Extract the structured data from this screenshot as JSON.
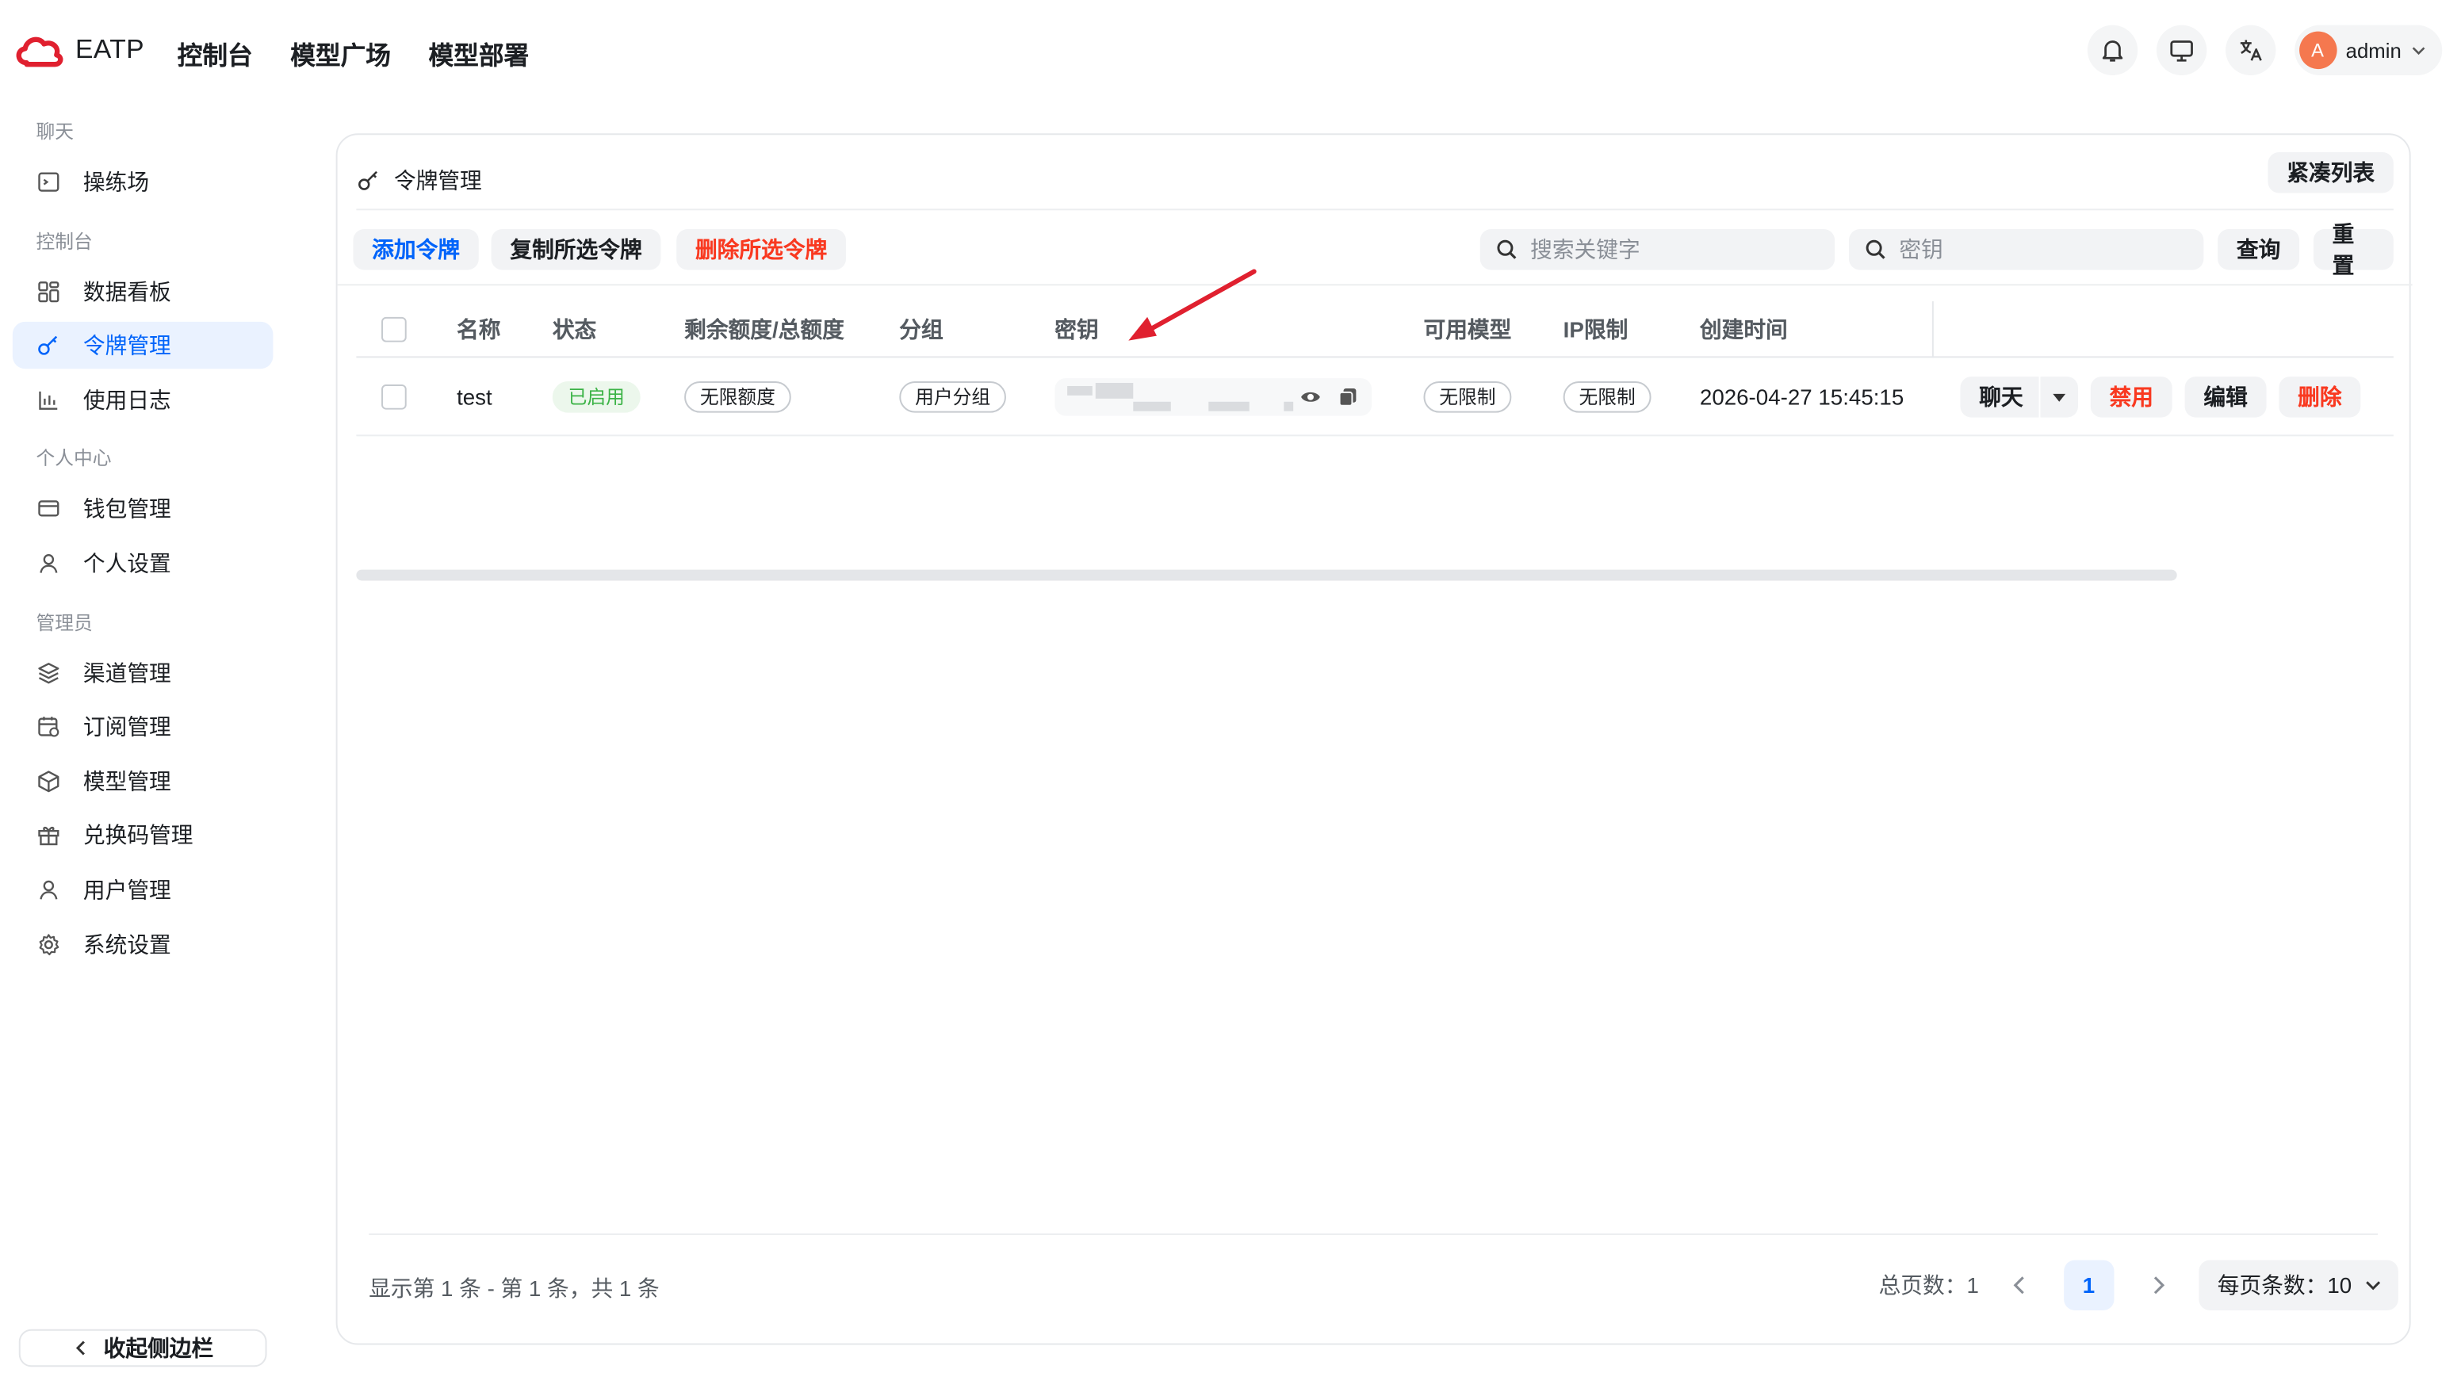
{
  "brand": {
    "name": "EATP",
    "color": "#e0202f"
  },
  "top_nav": [
    "控制台",
    "模型广场",
    "模型部署"
  ],
  "header": {
    "icons": [
      "bell-icon",
      "monitor-icon",
      "translate-icon"
    ],
    "user": {
      "avatar_letter": "A",
      "name": "admin"
    }
  },
  "sidebar": {
    "groups": [
      {
        "title": "聊天",
        "items": [
          {
            "label": "操练场",
            "icon": "terminal-icon"
          }
        ]
      },
      {
        "title": "控制台",
        "items": [
          {
            "label": "数据看板",
            "icon": "dashboard-icon"
          },
          {
            "label": "令牌管理",
            "icon": "key-icon",
            "active": true
          },
          {
            "label": "使用日志",
            "icon": "chart-icon"
          }
        ]
      },
      {
        "title": "个人中心",
        "items": [
          {
            "label": "钱包管理",
            "icon": "wallet-icon"
          },
          {
            "label": "个人设置",
            "icon": "user-icon"
          }
        ]
      },
      {
        "title": "管理员",
        "items": [
          {
            "label": "渠道管理",
            "icon": "layers-icon"
          },
          {
            "label": "订阅管理",
            "icon": "calendar-icon"
          },
          {
            "label": "模型管理",
            "icon": "cube-icon"
          },
          {
            "label": "兑换码管理",
            "icon": "gift-icon"
          },
          {
            "label": "用户管理",
            "icon": "user-icon"
          },
          {
            "label": "系统设置",
            "icon": "gear-icon"
          }
        ]
      }
    ],
    "collapse_label": "收起侧边栏"
  },
  "page": {
    "title": "令牌管理",
    "compact_label": "紧凑列表"
  },
  "toolbar": {
    "add_label": "添加令牌",
    "copy_label": "复制所选令牌",
    "delete_label": "删除所选令牌",
    "search_keyword_placeholder": "搜索关键字",
    "search_key_placeholder": "密钥",
    "query_label": "查询",
    "reset_label": "重置"
  },
  "table": {
    "columns": [
      "名称",
      "状态",
      "剩余额度/总额度",
      "分组",
      "密钥",
      "可用模型",
      "IP限制",
      "创建时间"
    ],
    "rows": [
      {
        "name": "test",
        "status": "已启用",
        "quota": "无限额度",
        "group": "用户分组",
        "models": "无限制",
        "ip": "无限制",
        "created": "2026-04-27 15:45:15",
        "actions": {
          "chat": "聊天",
          "disable": "禁用",
          "edit": "编辑",
          "delete": "删除"
        }
      }
    ]
  },
  "footer": {
    "info": "显示第 1 条 - 第 1 条，共 1 条",
    "total_pages": "总页数：1",
    "current_page": "1",
    "page_size": "每页条数：10"
  },
  "colors": {
    "primary": "#0064fa",
    "danger": "#f93920",
    "success": "#3bb346",
    "annotation_arrow": "#e0202f"
  }
}
